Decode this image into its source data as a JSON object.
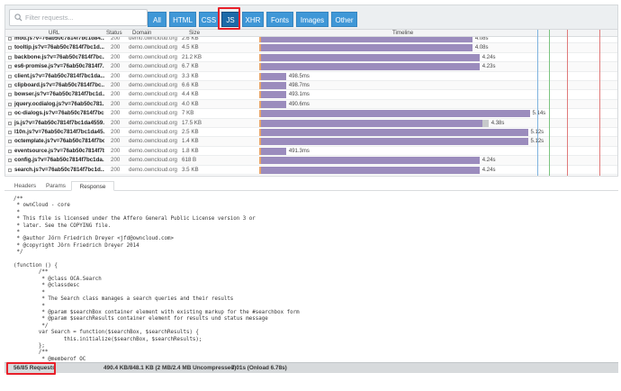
{
  "search": {
    "placeholder": "Filter requests...",
    "icon": "search-icon"
  },
  "filters": [
    {
      "label": "All",
      "active": false
    },
    {
      "label": "HTML",
      "active": false
    },
    {
      "label": "CSS",
      "active": false
    },
    {
      "label": "JS",
      "active": true
    },
    {
      "label": "XHR",
      "active": false
    },
    {
      "label": "Fonts",
      "active": false
    },
    {
      "label": "Images",
      "active": false
    },
    {
      "label": "Other",
      "active": false
    }
  ],
  "columns": {
    "url": "URL",
    "status": "Status",
    "domain": "Domain",
    "size": "Size",
    "timeline": "Timeline"
  },
  "requests": [
    {
      "url": "mod.js?v=76ab50c7814f7bc1d84...",
      "status": "200",
      "domain": "demo.owncloud.org",
      "size": "2.6 KB",
      "time": "4.08s",
      "start": 0.0,
      "end": 0.59
    },
    {
      "url": "tooltip.js?v=76ab50c7814f7bc1d...",
      "status": "200",
      "domain": "demo.owncloud.org",
      "size": "4.5 KB",
      "time": "4.08s",
      "start": 0.0,
      "end": 0.59
    },
    {
      "url": "backbone.js?v=76ab50c7814f7bc...",
      "status": "200",
      "domain": "demo.owncloud.org",
      "size": "21.2 KB",
      "time": "4.24s",
      "start": 0.0,
      "end": 0.61
    },
    {
      "url": "es6-promise.js?v=76ab50c7814f7...",
      "status": "200",
      "domain": "demo.owncloud.org",
      "size": "6.7 KB",
      "time": "4.23s",
      "start": 0.0,
      "end": 0.61
    },
    {
      "url": "client.js?v=76ab50c7814f7bc1da...",
      "status": "200",
      "domain": "demo.owncloud.org",
      "size": "3.3 KB",
      "time": "498.5ms",
      "start": 0.0,
      "end": 0.07
    },
    {
      "url": "clipboard.js?v=76ab50c7814f7bc...",
      "status": "200",
      "domain": "demo.owncloud.org",
      "size": "6.6 KB",
      "time": "498.7ms",
      "start": 0.0,
      "end": 0.07
    },
    {
      "url": "bowser.js?v=76ab50c7814f7bc1d...",
      "status": "200",
      "domain": "demo.owncloud.org",
      "size": "4.4 KB",
      "time": "493.1ms",
      "start": 0.0,
      "end": 0.07
    },
    {
      "url": "jquery.ocdialog.js?v=76ab50c781...",
      "status": "200",
      "domain": "demo.owncloud.org",
      "size": "4.0 KB",
      "time": "490.6ms",
      "start": 0.0,
      "end": 0.07
    },
    {
      "url": "oc-dialogs.js?v=76ab50c7814f7bc...",
      "status": "200",
      "domain": "demo.owncloud.org",
      "size": "7 KB",
      "time": "5.14s",
      "start": 0.0,
      "end": 0.75
    },
    {
      "url": "js.js?v=76ab50c7814f7bc1da4559...",
      "status": "200",
      "domain": "demo.owncloud.org",
      "size": "17.5 KB",
      "time": "4.38s",
      "start": 0.0,
      "end": 0.635
    },
    {
      "url": "l10n.js?v=76ab50c7814f7bc1da45...",
      "status": "200",
      "domain": "demo.owncloud.org",
      "size": "2.5 KB",
      "time": "5.12s",
      "start": 0.0,
      "end": 0.745
    },
    {
      "url": "octemplate.js?v=76ab50c7814f7bc...",
      "status": "200",
      "domain": "demo.owncloud.org",
      "size": "1.4 KB",
      "time": "5.12s",
      "start": 0.0,
      "end": 0.745
    },
    {
      "url": "eventsource.js?v=76ab50c7814f7b...",
      "status": "200",
      "domain": "demo.owncloud.org",
      "size": "1.8 KB",
      "time": "491.3ms",
      "start": 0.0,
      "end": 0.07
    },
    {
      "url": "config.js?v=76ab50c7814f7bc1da...",
      "status": "200",
      "domain": "demo.owncloud.org",
      "size": "618 B",
      "time": "4.24s",
      "start": 0.0,
      "end": 0.61
    },
    {
      "url": "search.js?v=76ab50c7814f7bc1d...",
      "status": "200",
      "domain": "demo.owncloud.org",
      "size": "3.5 KB",
      "time": "4.24s",
      "start": 0.0,
      "end": 0.61
    }
  ],
  "detail_tabs": [
    {
      "label": "Headers",
      "active": false
    },
    {
      "label": "Params",
      "active": false
    },
    {
      "label": "Response",
      "active": true
    }
  ],
  "response_code": "/**\n * ownCloud - core\n *\n * This file is licensed under the Affero General Public License version 3 or\n * later. See the COPYING file.\n *\n * @author Jörn Friedrich Dreyer <jfd@owncloud.com>\n * @copyright Jörn Friedrich Dreyer 2014\n */\n\n(function () {\n        /**\n         * @class OCA.Search\n         * @classdesc\n         *\n         * The Search class manages a search queries and their results\n         *\n         * @param $searchBox container element with existing markup for the #searchbox form\n         * @param $searchResults container element for results und status message\n         */\n        var Search = function($searchBox, $searchResults) {\n                this.initialize($searchBox, $searchResults);\n        };\n        /**\n         * @memberof OC\n         */",
  "status": {
    "requests": "56/85 Requests",
    "transfer": "490.4 KB/848.1 KB  (2 MB/2.4 MB Uncompressed)",
    "time": "7.01s  (Onload 6.78s)"
  },
  "colors": {
    "tab_blue": "#3f97d7",
    "tab_active": "#1d6aa8",
    "bar": "#9b8cbd",
    "highlight_box": "#e8202a"
  }
}
